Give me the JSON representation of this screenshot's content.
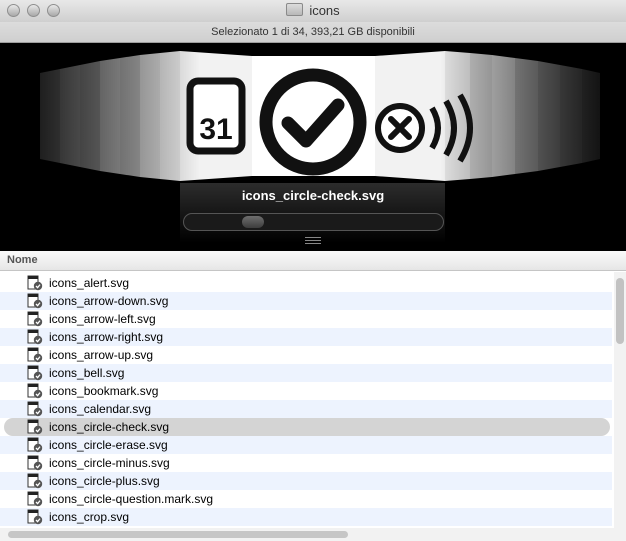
{
  "window": {
    "title": "icons"
  },
  "status": {
    "text": "Selezionato 1 di 34, 393,21 GB disponibili"
  },
  "coverflow": {
    "selected_label": "icons_circle-check.svg",
    "selected_icon": "circle-check-icon",
    "calendar_day": "31"
  },
  "list": {
    "column_header": "Nome",
    "selected_index": 8,
    "items": [
      "icons_alert.svg",
      "icons_arrow-down.svg",
      "icons_arrow-left.svg",
      "icons_arrow-right.svg",
      "icons_arrow-up.svg",
      "icons_bell.svg",
      "icons_bookmark.svg",
      "icons_calendar.svg",
      "icons_circle-check.svg",
      "icons_circle-erase.svg",
      "icons_circle-minus.svg",
      "icons_circle-plus.svg",
      "icons_circle-question.mark.svg",
      "icons_crop.svg"
    ]
  },
  "colors": {
    "row_alt": "#edf3fe",
    "selection": "#d4d4d4",
    "coverflow_bg": "#000000"
  }
}
